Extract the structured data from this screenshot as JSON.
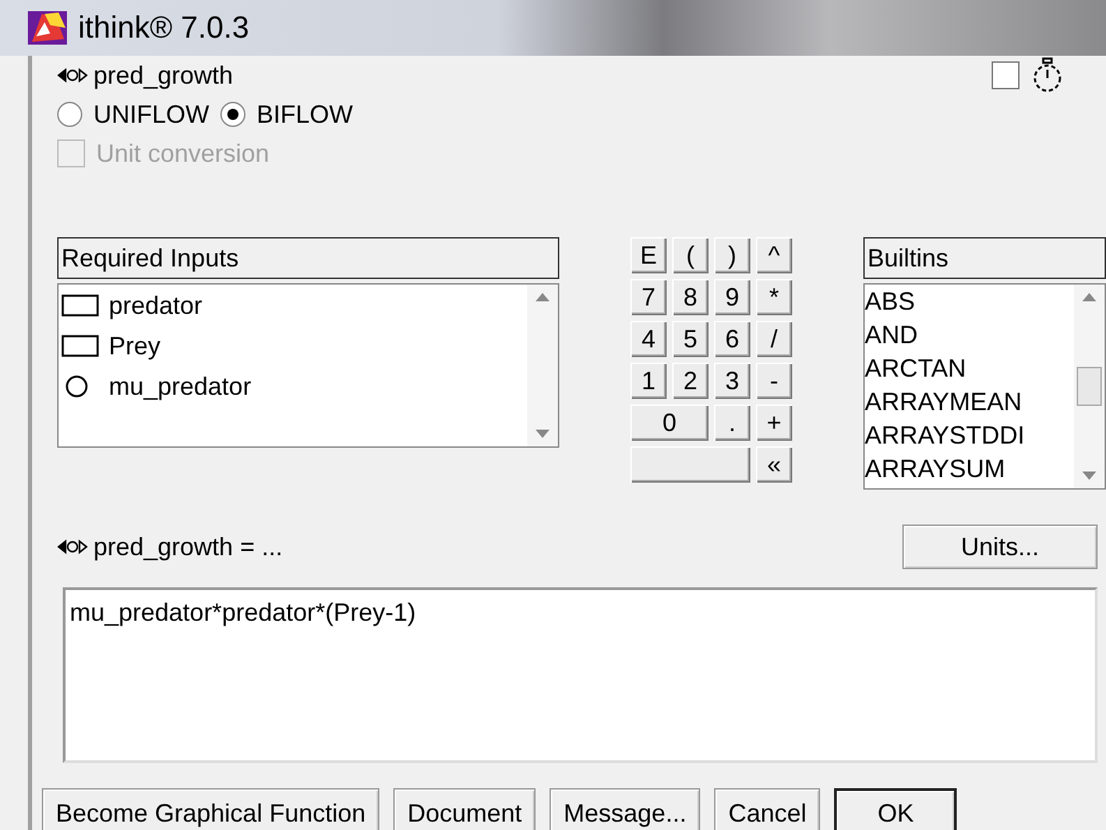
{
  "window": {
    "title": "ithink® 7.0.3"
  },
  "flow": {
    "name": "pred_growth",
    "timer_checked": false
  },
  "flow_types": [
    {
      "label": "UNIFLOW",
      "selected": false
    },
    {
      "label": "BIFLOW",
      "selected": true
    }
  ],
  "unit_conversion": {
    "label": "Unit conversion",
    "checked": false,
    "disabled": true
  },
  "required_inputs": {
    "title": "Required Inputs",
    "items": [
      {
        "kind": "stock",
        "label": "predator"
      },
      {
        "kind": "stock",
        "label": "Prey"
      },
      {
        "kind": "converter",
        "label": "mu_predator"
      }
    ]
  },
  "keypad": [
    {
      "kind": "key",
      "label": "E"
    },
    {
      "kind": "key",
      "label": "("
    },
    {
      "kind": "key",
      "label": ")"
    },
    {
      "kind": "key",
      "label": "^"
    },
    {
      "kind": "key",
      "label": "7"
    },
    {
      "kind": "key",
      "label": "8"
    },
    {
      "kind": "key",
      "label": "9"
    },
    {
      "kind": "key",
      "label": "*"
    },
    {
      "kind": "key",
      "label": "4"
    },
    {
      "kind": "key",
      "label": "5"
    },
    {
      "kind": "key",
      "label": "6"
    },
    {
      "kind": "key",
      "label": "/"
    },
    {
      "kind": "key",
      "label": "1"
    },
    {
      "kind": "key",
      "label": "2"
    },
    {
      "kind": "key",
      "label": "3"
    },
    {
      "kind": "key",
      "label": "-"
    },
    {
      "kind": "wide",
      "label": "0"
    },
    {
      "kind": "key",
      "label": "."
    },
    {
      "kind": "key",
      "label": "+"
    },
    {
      "kind": "blank"
    },
    {
      "kind": "key",
      "label": "«"
    }
  ],
  "builtins": {
    "title": "Builtins",
    "items": [
      "ABS",
      "AND",
      "ARCTAN",
      "ARRAYMEAN",
      "ARRAYSTDDI",
      "ARRAYSUM"
    ]
  },
  "equation": {
    "label": "pred_growth = ...",
    "value": "mu_predator*predator*(Prey-1)"
  },
  "units_button": "Units...",
  "buttons": [
    {
      "label": "Become Graphical Function",
      "default": false
    },
    {
      "label": "Document",
      "default": false
    },
    {
      "label": "Message...",
      "default": false
    },
    {
      "label": "Cancel",
      "default": false
    },
    {
      "label": "OK",
      "default": true
    }
  ]
}
